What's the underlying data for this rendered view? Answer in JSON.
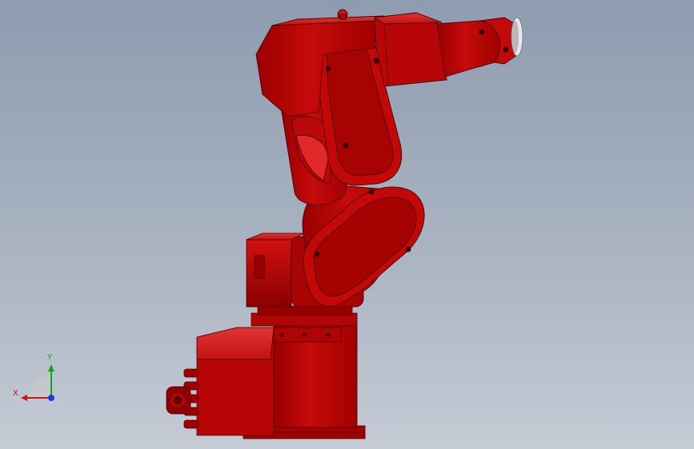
{
  "viewport": {
    "background_top": "#8e9cb0",
    "background_bottom": "#c4cbd5"
  },
  "model": {
    "body_color": "#c00808",
    "shadow_color": "#7a0000",
    "highlight_color": "#e23030"
  },
  "triad": {
    "x_label": "X",
    "y_label": "Y",
    "x_color": "#d21414",
    "y_color": "#18a018",
    "z_color": "#1a3ad8"
  }
}
